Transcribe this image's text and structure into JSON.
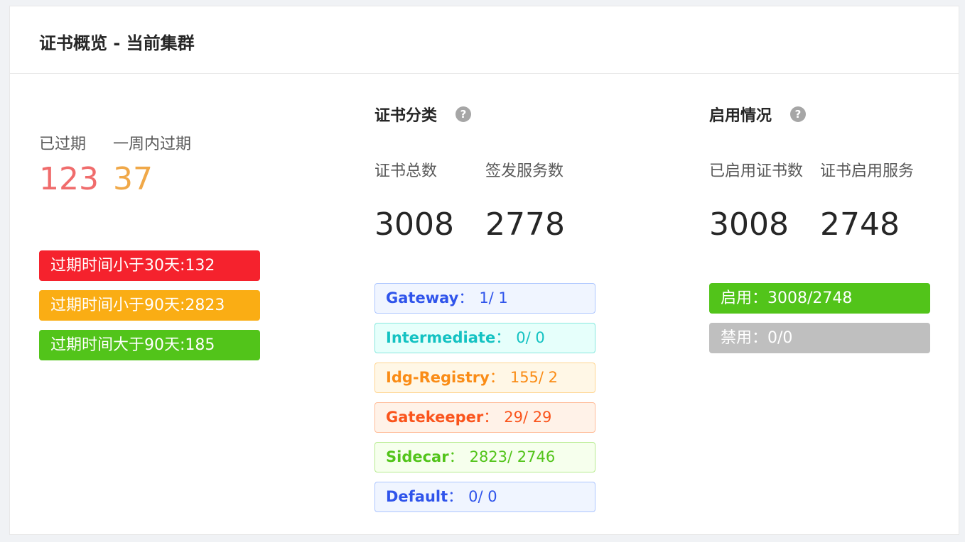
{
  "header": {
    "title": "证书概览 - 当前集群"
  },
  "expiry": {
    "expired_label": "已过期",
    "week_label": "一周内过期",
    "expired_value": "123",
    "week_value": "37",
    "tags": [
      {
        "label": "过期时间小于30天:132",
        "color": "#f5222d"
      },
      {
        "label": "过期时间小于90天:2823",
        "color": "#faad14"
      },
      {
        "label": "过期时间大于90天:185",
        "color": "#52c41a"
      }
    ]
  },
  "category": {
    "title": "证书分类",
    "help_icon": "question-circle-icon",
    "total_label": "证书总数",
    "issued_label": "签发服务数",
    "total_value": "3008",
    "issued_value": "2778",
    "tags": [
      {
        "name": "Gateway",
        "sep": "：",
        "value": "1/ 1",
        "color": "#2f54eb",
        "bg": "#f0f5ff",
        "border": "#adc6ff"
      },
      {
        "name": "Intermediate",
        "sep": "：",
        "value": "0/ 0",
        "color": "#13c2c2",
        "bg": "#e6fffb",
        "border": "#87e8de"
      },
      {
        "name": "Idg-Registry",
        "sep": "：",
        "value": "155/ 2",
        "color": "#fa8c16",
        "bg": "#fff7e6",
        "border": "#ffd591"
      },
      {
        "name": "Gatekeeper",
        "sep": "：",
        "value": "29/ 29",
        "color": "#fa541c",
        "bg": "#fff2e8",
        "border": "#ffbb96"
      },
      {
        "name": "Sidecar",
        "sep": "：",
        "value": "2823/ 2746",
        "color": "#52c41a",
        "bg": "#f6ffed",
        "border": "#b7eb8f"
      },
      {
        "name": "Default",
        "sep": "：",
        "value": "0/ 0",
        "color": "#2f54eb",
        "bg": "#f0f5ff",
        "border": "#adc6ff"
      }
    ]
  },
  "usage": {
    "title": "启用情况",
    "help_icon": "question-circle-icon",
    "enabled_label": "已启用证书数",
    "service_label": "证书启用服务",
    "enabled_value": "3008",
    "service_value": "2748",
    "tags": [
      {
        "label": "启用：3008/2748",
        "color": "#52c41a"
      },
      {
        "label": "禁用：0/0",
        "color": "#bfbfbf"
      }
    ]
  }
}
